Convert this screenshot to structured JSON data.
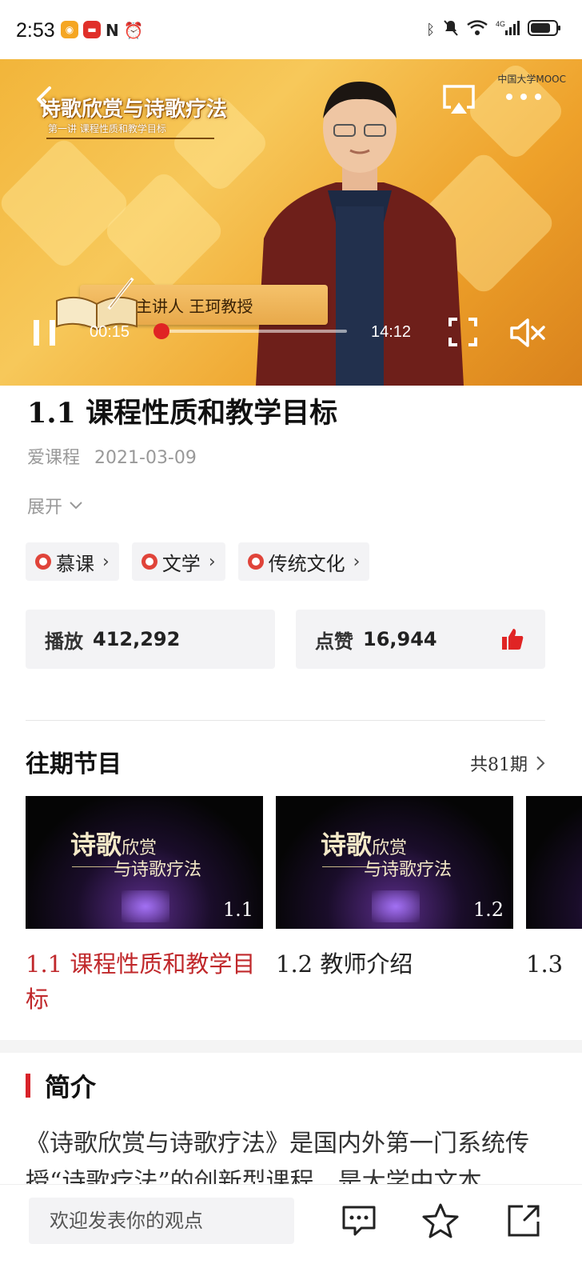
{
  "status_bar": {
    "time": "2:53",
    "left_icons": [
      "weibo-icon",
      "app-red-icon",
      "nfc-icon",
      "alarm-icon"
    ],
    "right_icons": [
      "bluetooth-icon",
      "mute-bell-icon",
      "wifi-icon",
      "signal-4g-icon",
      "battery-icon"
    ]
  },
  "player": {
    "slide_title": "诗歌欣赏与诗歌疗法",
    "slide_subtitle": "第一讲 课程性质和教学目标",
    "source_logo": "中国大学MOOC",
    "nameplate": "主讲人  王珂教授",
    "current_time": "00:15",
    "total_time": "14:12",
    "progress": 0.018,
    "accent": "#e02424"
  },
  "video": {
    "title": "1.1  课程性质和教学目标",
    "author": "爱课程",
    "date": "2021-03-09",
    "expand_label": "展开"
  },
  "tags": [
    {
      "label": "慕课"
    },
    {
      "label": "文学"
    },
    {
      "label": "传统文化"
    }
  ],
  "stats": {
    "plays_label": "播放",
    "plays_value": "412,292",
    "likes_label": "点赞",
    "likes_value": "16,944"
  },
  "episodes_section": {
    "title": "往期节目",
    "count_label": "共81期",
    "thumb_title_main": "诗歌",
    "thumb_title_small": "欣赏",
    "thumb_title_line2": "与诗歌疗法",
    "items": [
      {
        "num": "1.1",
        "title": "1.1 课程性质和教学目标",
        "active": true
      },
      {
        "num": "1.2",
        "title": "1.2 教师介绍",
        "active": false
      },
      {
        "num": "",
        "title": "1.3",
        "active": false
      }
    ]
  },
  "intro": {
    "heading": "简介",
    "text": "《诗歌欣赏与诗歌疗法》是国内外第一门系统传授“诗歌疗法”的创新型课程，是大学中文本"
  },
  "bottom_bar": {
    "comment_placeholder": "欢迎发表你的观点",
    "icons": [
      "comment-icon",
      "star-icon",
      "share-icon"
    ]
  },
  "colors": {
    "brand_red": "#c0282b",
    "tag_bg": "#f3f3f5"
  }
}
